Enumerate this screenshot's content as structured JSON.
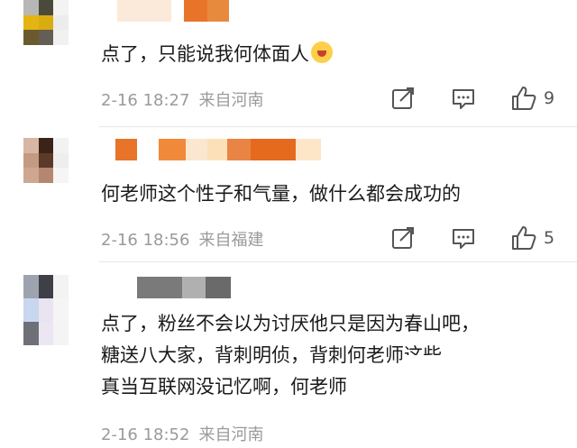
{
  "comments": [
    {
      "text_lines": [
        "点了，只能说我何体面人"
      ],
      "emoji": "grinning-sweat-emoji",
      "date": "2-16 18:27",
      "location": "来自河南",
      "likes": "9"
    },
    {
      "text_lines": [
        "何老师这个性子和气量，做什么都会成功的"
      ],
      "date": "2-16 18:56",
      "location": "来自福建",
      "likes": "5"
    },
    {
      "text_lines": [
        "点了，粉丝不会以为讨厌他只是因为春山吧，",
        "糖送八大家，背刺明侦，背刺何老师这些",
        "真当互联网没记忆啊，何老师"
      ],
      "date": "2-16 18:52",
      "location": "来自河南",
      "likes": ""
    }
  ],
  "icons": [
    "share-icon",
    "comment-icon",
    "like-icon"
  ],
  "colors": {
    "meta_text": "#9a9a9a",
    "divider": "#e6e6e6",
    "name_orange": "#e8742a"
  }
}
